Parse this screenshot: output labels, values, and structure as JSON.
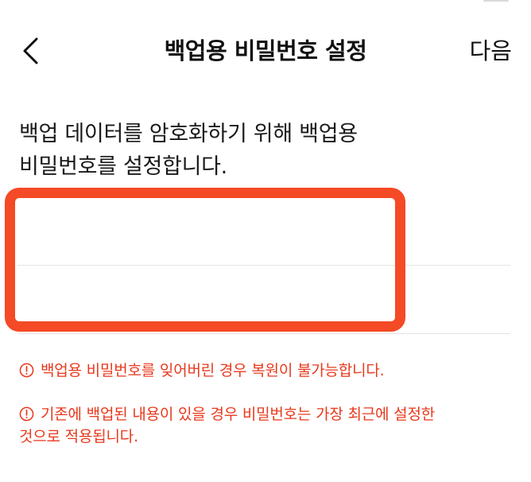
{
  "header": {
    "title": "백업용 비밀번호 설정",
    "next_label": "다음",
    "back_icon": "chevron-left-icon"
  },
  "description": {
    "line1": "백업 데이터를 암호화하기 위해 백업용",
    "line2": "비밀번호를 설정합니다."
  },
  "form": {
    "password_value": "",
    "password_placeholder": "",
    "confirm_value": "",
    "confirm_placeholder": ""
  },
  "warnings": {
    "icon": "alert-circle-icon",
    "item1": "백업용 비밀번호를 잊어버린 경우 복원이 불가능합니다.",
    "item2_line1": "기존에 백업된 내용이 있을 경우 비밀번호는 가장 최근에 설정한",
    "item2_line2": "것으로 적용됩니다."
  },
  "colors": {
    "highlight": "#f44a25",
    "warning_text": "#e8391d",
    "divider": "#e3e3e3"
  }
}
